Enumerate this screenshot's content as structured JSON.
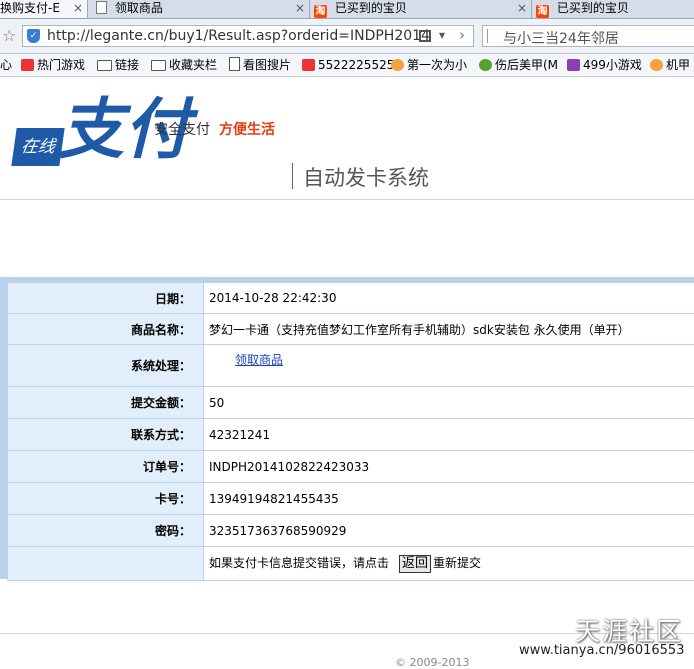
{
  "browser": {
    "tabs": [
      {
        "label": "换购支付-E",
        "icon": "page-icon"
      },
      {
        "label": "领取商品",
        "icon": "page-icon"
      },
      {
        "label": "已买到的宝贝",
        "icon": "taobao-icon"
      },
      {
        "label": "已买到的宝贝",
        "icon": "taobao-icon"
      }
    ],
    "tab_close": "×",
    "url": "http://legante.cn/buy1/Result.asp?orderid=INDPH2014",
    "search_text": "与小三当24年邻居",
    "bookmarks": [
      {
        "label": "心",
        "icon": ""
      },
      {
        "label": "热门游戏",
        "icon": "game-icon"
      },
      {
        "label": "链接",
        "icon": "folder-icon"
      },
      {
        "label": "收藏夹栏",
        "icon": "folder-icon"
      },
      {
        "label": "看图搜片",
        "icon": "page-icon"
      },
      {
        "label": "5522225525",
        "icon": "red-icon"
      },
      {
        "label": "第一次为小",
        "icon": "face-icon"
      },
      {
        "label": "伤后美甲(M",
        "icon": "green-icon"
      },
      {
        "label": "499小游戏",
        "icon": "purple-icon"
      },
      {
        "label": "机甲",
        "icon": "face-icon"
      }
    ]
  },
  "header": {
    "logo_small": "在线",
    "logo_big": "支付",
    "tagline_1": "安全支付",
    "tagline_2": "方便生活",
    "system_title": "自动发卡系统"
  },
  "result": {
    "rows": [
      {
        "label": "日期：",
        "value": "2014-10-28 22:42:30"
      },
      {
        "label": "商品名称：",
        "value": "梦幻一卡通（支持充值梦幻工作室所有手机辅助）sdk安装包 永久使用（单开）"
      },
      {
        "label": "系统处理：",
        "link": "领取商品"
      },
      {
        "label": "提交金额：",
        "value": "50"
      },
      {
        "label": "联系方式：",
        "value": "42321241"
      },
      {
        "label": "订单号：",
        "value": "INDPH2014102822423033"
      },
      {
        "label": "卡号：",
        "value": "13949194821455435"
      },
      {
        "label": "密码：",
        "value": "323517363768590929"
      }
    ],
    "error_text": "如果支付卡信息提交错误，请点击",
    "back_button": "返回",
    "resubmit_text": "重新提交"
  },
  "footer": {
    "copyright": "© 2009-2013",
    "watermark_brand": "天涯社区",
    "watermark_url": "www.tianya.cn/96016553"
  },
  "colors": {
    "brand_blue": "#1f5aa8",
    "accent_red": "#e23c11",
    "table_border": "#b9d4ea",
    "label_bg": "#e2eef9"
  }
}
